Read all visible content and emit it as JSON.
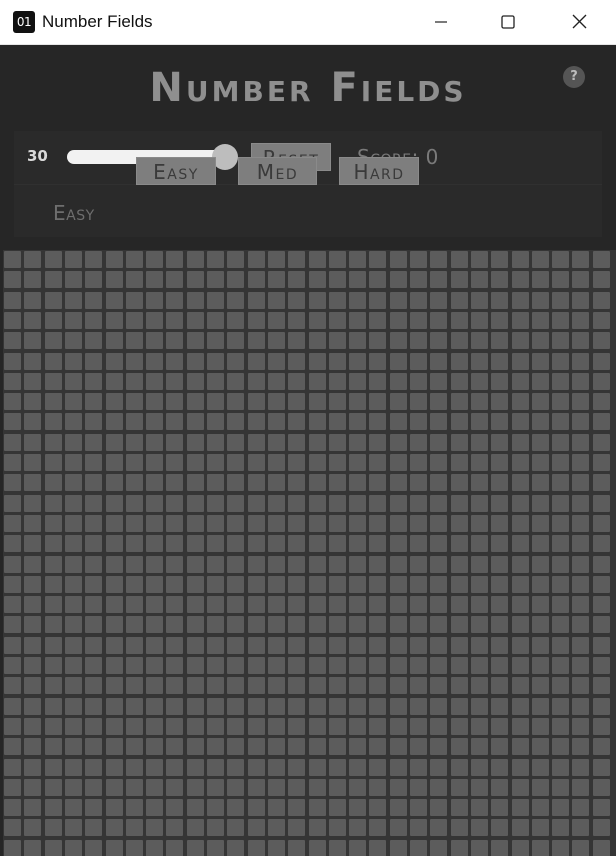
{
  "window": {
    "app_icon_text": "01",
    "title": "Number Fields"
  },
  "header": {
    "game_title": "Number Fields",
    "help_label": "?"
  },
  "controls": {
    "grid_size": "30",
    "slider_min": 10,
    "slider_max": 30,
    "slider_value": 30,
    "reset_label": "Reset",
    "score_text": "Score: 0",
    "current_difficulty": "Easy",
    "difficulty_buttons": {
      "easy": "Easy",
      "med": "Med",
      "hard": "Hard"
    }
  },
  "board": {
    "columns": 30,
    "rows_visible": 30,
    "cell_color": "#5c5c5c",
    "background_color": "#353535"
  },
  "colors": {
    "button_bg": "#7e7e7e",
    "button_text": "#3a3a3a",
    "title_text": "#8f8f8f"
  }
}
